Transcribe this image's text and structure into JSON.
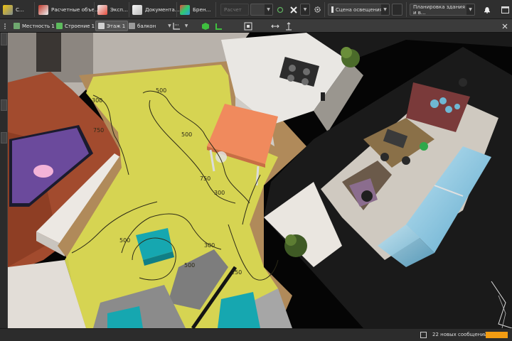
{
  "toolbar": {
    "items": [
      {
        "label": "С...",
        "icon": "measure-icon"
      },
      {
        "label": "Расчетные объе...",
        "icon": "calc-objects-icon"
      },
      {
        "label": "Эксп...",
        "icon": "export-icon"
      },
      {
        "label": "Документа...",
        "icon": "documents-icon"
      },
      {
        "label": "Брен...",
        "icon": "brands-icon"
      }
    ],
    "calc_label": "Расчет",
    "scene_select": "Сцена освещения 1",
    "plan_select": "Планировка здания и в..."
  },
  "toolbar2": {
    "crumbs": [
      {
        "label": "Местность 1",
        "active": false
      },
      {
        "label": "Строение 1",
        "active": false
      },
      {
        "label": "Этаж 1",
        "active": true
      },
      {
        "label": "балкон",
        "active": false
      }
    ]
  },
  "contours": [
    "500",
    "300",
    "500",
    "750",
    "300",
    "500",
    "500",
    "250",
    "300",
    "750"
  ],
  "status": {
    "messages": "22 новых сообщений",
    "progress": 1.0
  },
  "colors": {
    "accent": "#f39c12",
    "illuminance": "#d8d852",
    "table": "#f08a5d",
    "ottoman": "#16a7b0",
    "glass": "#6fb8d3"
  }
}
